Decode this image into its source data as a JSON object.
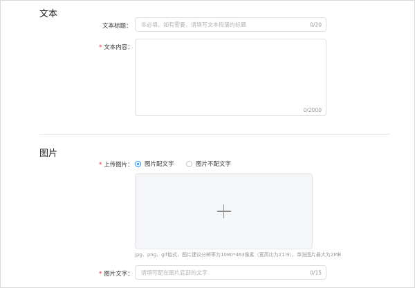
{
  "text_section": {
    "title": "文本",
    "text_title": {
      "label": "文本标题：",
      "placeholder": "非必填，如有需要，请填写文本段落的标题",
      "count": "0/20"
    },
    "text_content": {
      "required_mark": "*",
      "label": "文本内容：",
      "count": "0/2000"
    }
  },
  "image_section": {
    "title": "图片",
    "upload": {
      "required_mark": "*",
      "label": "上传图片：",
      "options": [
        {
          "label": "图片配文字",
          "checked": true
        },
        {
          "label": "图片不配文字",
          "checked": false
        }
      ],
      "hint": "jpg、png、gif格式，图片建议分辨率为1080*463像素（宽高比为21:9），单张图片最大为2MB"
    },
    "image_text": {
      "required_mark": "*",
      "label": "图片文字：",
      "placeholder": "请填写配在图片底部的文字",
      "count": "0/15"
    }
  },
  "colors": {
    "accent": "#1890ff",
    "required": "#f5222d",
    "border": "#dcdfe6",
    "upload_bg": "#f5f6f7"
  },
  "icons": {
    "upload": "plus-icon"
  }
}
